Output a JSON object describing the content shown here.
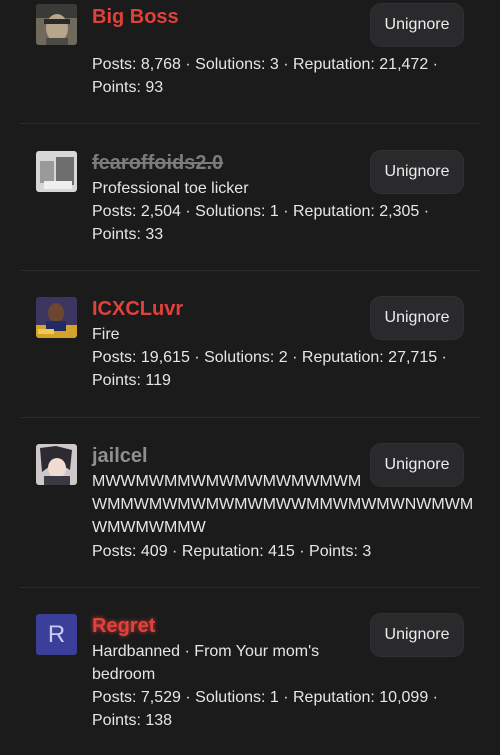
{
  "users": [
    {
      "name": "Big Boss",
      "tagline": "",
      "stats_1": "Posts: 8,768 · Solutions: 3 · Reputation: 21,472 ·",
      "stats_2": "Points: 93",
      "button": "Unignore"
    },
    {
      "name": "fearoffoids2.0",
      "tagline": "Professional toe licker",
      "stats_1": "Posts: 2,504 · Solutions: 1 · Reputation: 2,305 ·",
      "stats_2": "Points: 33",
      "button": "Unignore"
    },
    {
      "name": "ICXCLuvr",
      "tagline": "Fire",
      "stats_1": "Posts: 19,615 · Solutions: 2 · Reputation: 27,715 ·",
      "stats_2": "Points: 119",
      "button": "Unignore"
    },
    {
      "name": "jailcel",
      "tagline_1": "MWWMWMMWMWMWMWMWMWM",
      "tagline_2": "WMMWMWMWMWMWMWWMMWMWMWNWMWM",
      "tagline_3": "WMWMWMMW",
      "stats_1": "Posts: 409 · Reputation: 415 · Points: 3",
      "button": "Unignore"
    },
    {
      "name": "Regret",
      "avatar_letter": "R",
      "tagline_1": "Hardbanned · From Your mom's",
      "tagline_2": "bedroom",
      "stats_1": "Posts: 7,529 · Solutions: 1 · Reputation: 10,099 ·",
      "stats_2": "Points: 138",
      "button": "Unignore"
    }
  ],
  "colors": {
    "background": "#1b1b1c",
    "username_red": "#e0413a",
    "username_grey": "#8f8f8f",
    "button_bg": "#2a2a2c",
    "avatar_letter_bg": "#3b3f9a"
  }
}
